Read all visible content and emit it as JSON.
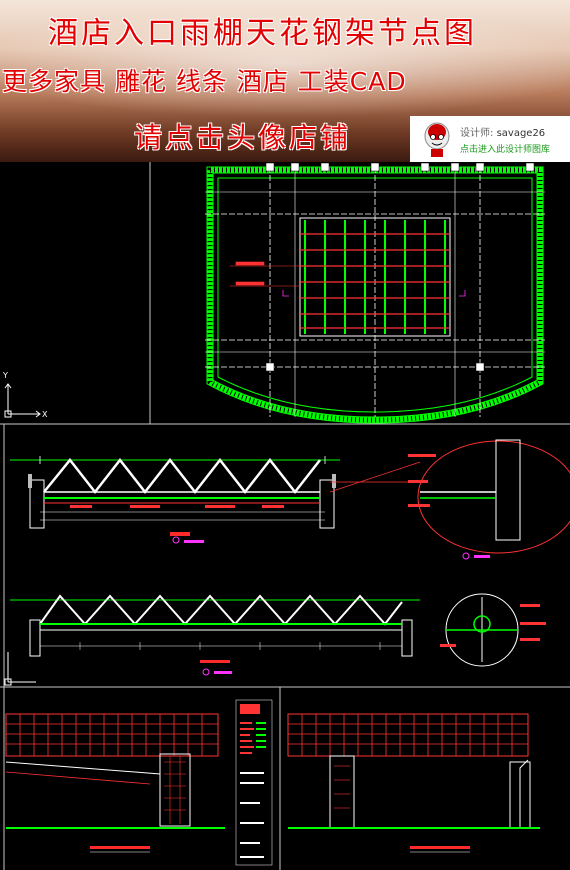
{
  "banner": {
    "title": "酒店入口雨棚天花钢架节点图",
    "subtitle": "更多家具 雕花 线条 酒店 工装CAD",
    "cta": "请点击头像店铺"
  },
  "designer_card": {
    "label": "设计师:",
    "name": "savage26",
    "link": "点击进入此设计师图库"
  },
  "colors": {
    "banner_text": "#e30000",
    "cad_green": "#00ff00",
    "cad_red": "#ff2a2a",
    "cad_white": "#ffffff",
    "cad_magenta": "#ff33ff",
    "background": "#000000"
  },
  "drawing": {
    "axis_y": "Y",
    "axis_x": "X"
  }
}
